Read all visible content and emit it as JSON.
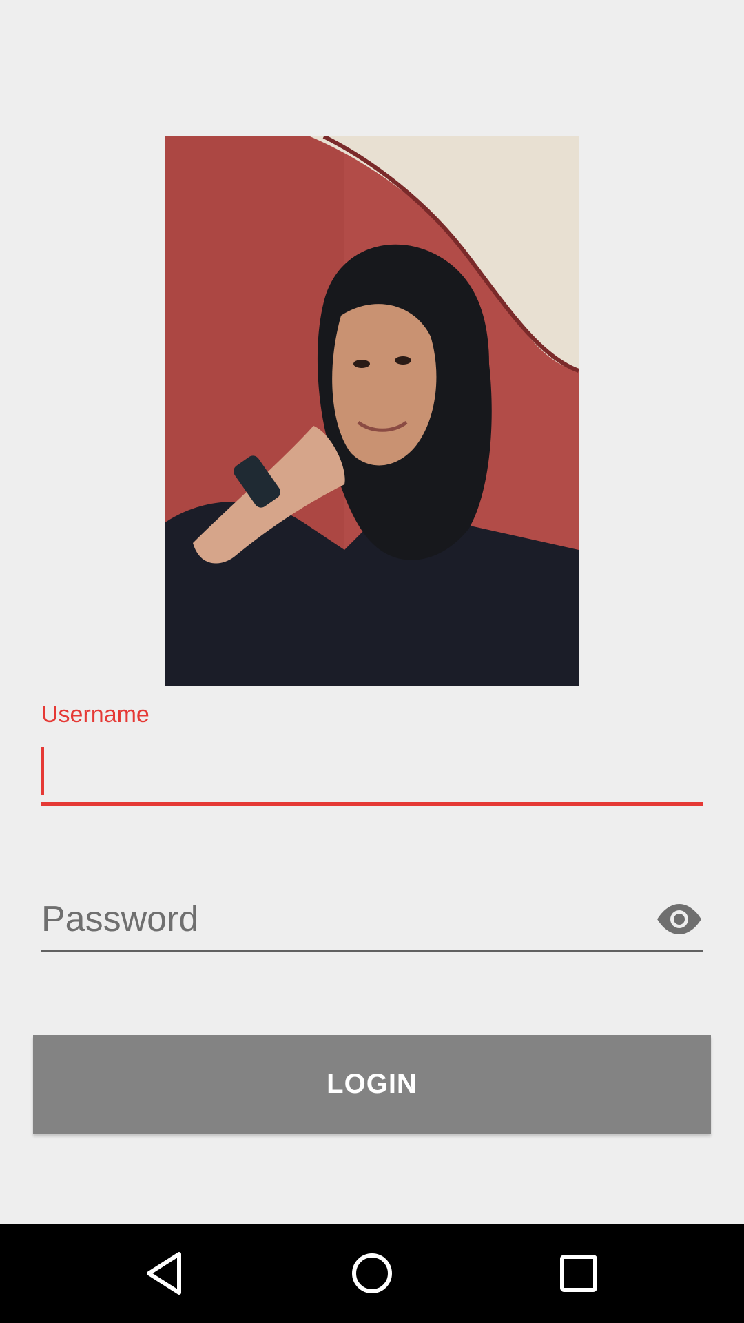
{
  "profile": {
    "photo_icon": "profile-photo"
  },
  "username": {
    "label": "Username",
    "value": ""
  },
  "password": {
    "placeholder": "Password",
    "toggle_icon": "eye-icon"
  },
  "actions": {
    "login_label": "LOGIN"
  },
  "navigation": {
    "back_icon": "back-triangle-icon",
    "home_icon": "home-circle-icon",
    "recents_icon": "recents-square-icon"
  },
  "colors": {
    "accent": "#e53935",
    "button": "#838383",
    "background": "#eeeeee"
  }
}
